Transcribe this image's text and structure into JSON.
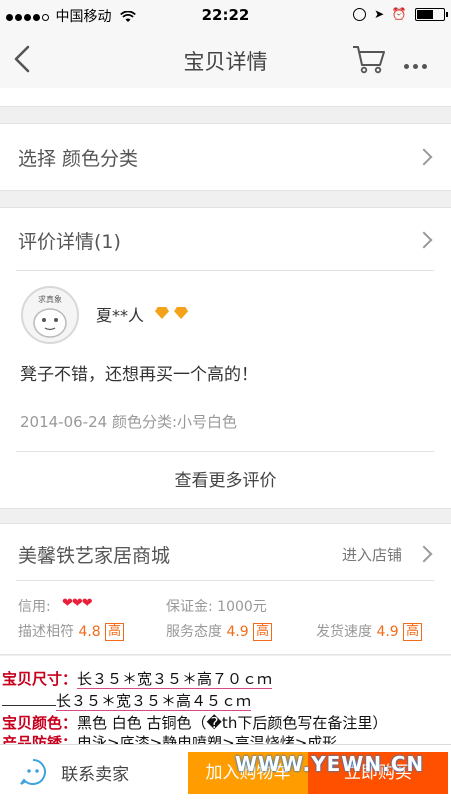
{
  "status_bar": {
    "carrier": "中国移动",
    "time": "22:22"
  },
  "nav": {
    "title": "宝贝详情"
  },
  "option_row": {
    "label": "选择 颜色分类"
  },
  "reviews": {
    "header": "评价详情(1)",
    "user_name": "夏**人",
    "avatar_text": "求真象",
    "comment": "凳子不错，还想再买一个高的！",
    "date": "2014-06-24",
    "variant": "颜色分类:小号白色",
    "more_link": "查看更多评价"
  },
  "shop": {
    "name": "美馨铁艺家居商城",
    "enter_label": "进入店铺",
    "credit_label": "信用:",
    "deposit": "保证金: 1000元",
    "ratings": [
      {
        "label": "描述相符",
        "score": "4.8",
        "tag": "高"
      },
      {
        "label": "服务态度",
        "score": "4.9",
        "tag": "高"
      },
      {
        "label": "发货速度",
        "score": "4.9",
        "tag": "高"
      }
    ]
  },
  "description": {
    "line1_key": "宝贝尺寸：",
    "line1_val": "长３５＊宽３５＊高７０ｃｍ",
    "line2_val": "长３５＊宽３５＊高４５ｃｍ",
    "line3_key": "宝贝颜色：",
    "line3_val": "黑色 白色 古铜色（�th下后颜色写在备注里）",
    "line4_key": "产品防锈：",
    "line4_val": "电泳>底漆>静电喷塑>高温烧烤>成形"
  },
  "bottom": {
    "contact_label": "联系卖家",
    "cart_label": "加入购物车",
    "buy_label": "立即购买",
    "watermark": "WWW.YEWN.CN"
  },
  "colors": {
    "accent_orange": "#ff5000",
    "cart_orange": "#ff9d00",
    "price_red": "#c8001e"
  }
}
